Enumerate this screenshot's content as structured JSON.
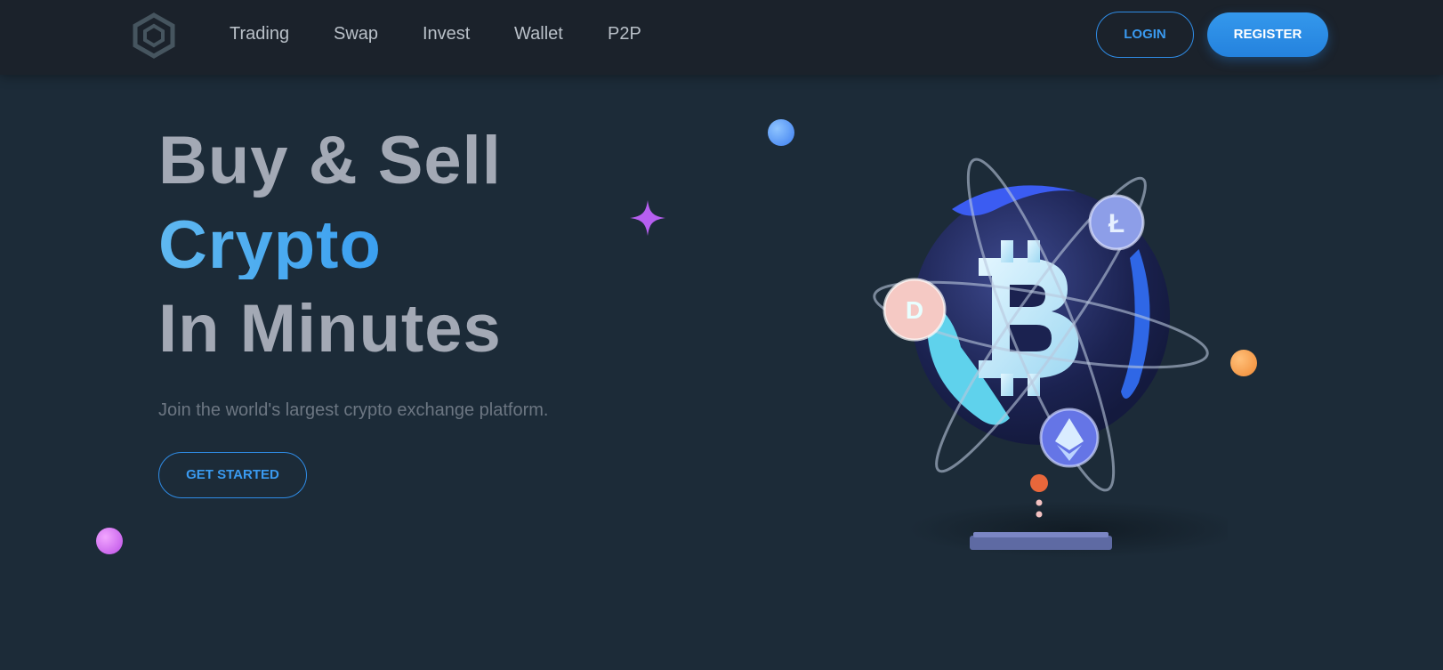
{
  "nav": {
    "links": [
      "Trading",
      "Swap",
      "Invest",
      "Wallet",
      "P2P"
    ],
    "login_label": "LOGIN",
    "register_label": "REGISTER"
  },
  "hero": {
    "line1": "Buy & Sell",
    "line2": "Crypto",
    "line3": "In Minutes",
    "subtitle": "Join the world's largest crypto exchange platform.",
    "cta_label": "GET STARTED"
  },
  "colors": {
    "background": "#1c2b38",
    "navbar": "#1b222b",
    "accent": "#2f8ce6",
    "headline": "#a3a9b5"
  },
  "icons": [
    "logo-icon",
    "sparkle-icon",
    "bitcoin-icon",
    "litecoin-icon",
    "dash-icon",
    "ethereum-icon"
  ]
}
